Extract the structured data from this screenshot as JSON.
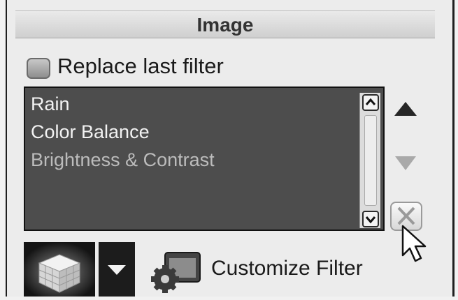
{
  "header": {
    "title": "Image"
  },
  "options": {
    "replace_last_filter_label": "Replace last filter",
    "replace_last_filter_checked": false
  },
  "filter_list": {
    "items": [
      {
        "label": "Rain"
      },
      {
        "label": "Color Balance"
      },
      {
        "label": "Brightness & Contrast"
      }
    ],
    "selected_index": 2
  },
  "icons": {
    "move_up": "triangle-up-icon",
    "move_down": "triangle-down-icon",
    "remove": "x-icon",
    "scroll_up": "chevron-up-icon",
    "scroll_down": "chevron-down-icon",
    "filter_preview": "cube-icon",
    "dropdown": "caret-down-icon",
    "customize": "gear-window-icon",
    "cursor": "mouse-pointer-icon"
  },
  "actions": {
    "customize_filter_label": "Customize Filter"
  }
}
